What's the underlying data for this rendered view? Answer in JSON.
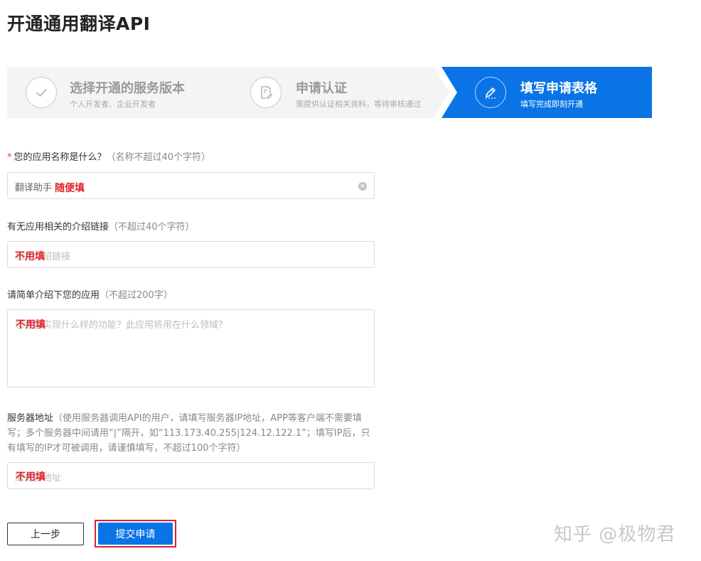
{
  "page": {
    "title": "开通通用翻译API"
  },
  "steps": [
    {
      "title": "选择开通的服务版本",
      "subtitle": "个人开发者、企业开发者",
      "state": "done",
      "icon": "check-icon"
    },
    {
      "title": "申请认证",
      "subtitle": "需提供认证相关资料，等待审核通过",
      "state": "done",
      "icon": "document-edit-icon"
    },
    {
      "title": "填写申请表格",
      "subtitle": "填写完成即刻开通",
      "state": "active",
      "icon": "pen-icon"
    }
  ],
  "form": {
    "app_name": {
      "required_mark": "*",
      "label": "您的应用名称是什么？",
      "hint": "（名称不超过40个字符）",
      "value": "翻译助手",
      "annotation": "随便填"
    },
    "intro_link": {
      "label": "有无应用相关的介绍链接",
      "hint": "（不超过40个字符）",
      "placeholder": "相关介绍链接",
      "annotation": "不用填"
    },
    "description": {
      "label": "请简单介绍下您的应用",
      "hint": "（不超过200字）",
      "placeholder": "您希望实现什么样的功能？此应用将用在什么领域？",
      "annotation": "不用填"
    },
    "server_address": {
      "label": "服务器地址",
      "hint": "（使用服务器调用API的用户，请填写服务器IP地址，APP等客户端不需要填写；多个服务器中间请用“|”隔开，如“113.173.40.255|124.12.122.1”；填写IP后，只有填写的IP才可被调用，请谨慎填写，不超过100个字符）",
      "placeholder": "服务器地址",
      "annotation": "不用填"
    }
  },
  "buttons": {
    "prev": "上一步",
    "submit": "提交申请"
  },
  "watermark": "知乎 @极物君",
  "colors": {
    "accent": "#0a74e6",
    "annotation": "#e0242b",
    "highlight_border": "#d8232a"
  }
}
